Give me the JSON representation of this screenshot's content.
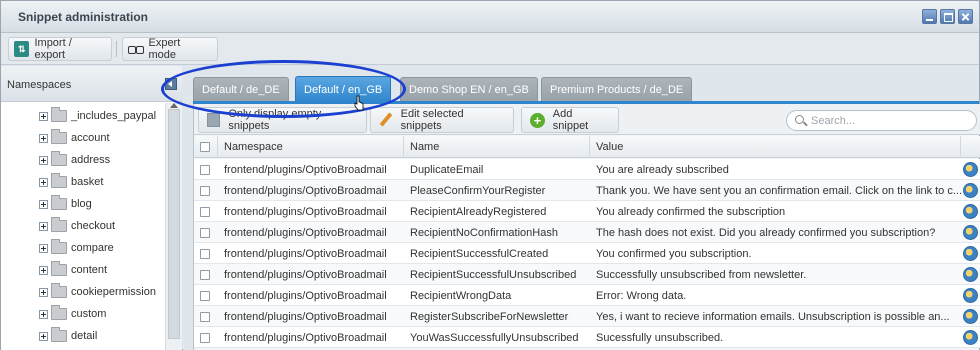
{
  "window": {
    "title": "Snippet administration"
  },
  "toolbar": {
    "import_label": "Import / export",
    "expert_label": "Expert mode"
  },
  "namespaces": {
    "header": "Namespaces",
    "items": [
      {
        "label": "_includes_paypal"
      },
      {
        "label": "account"
      },
      {
        "label": "address"
      },
      {
        "label": "basket"
      },
      {
        "label": "blog"
      },
      {
        "label": "checkout"
      },
      {
        "label": "compare"
      },
      {
        "label": "content"
      },
      {
        "label": "cookiepermission"
      },
      {
        "label": "custom"
      },
      {
        "label": "detail"
      }
    ]
  },
  "tabs": [
    {
      "label": "Default / de_DE",
      "active": false
    },
    {
      "label": "Default / en_GB",
      "active": true
    },
    {
      "label": "Demo Shop EN / en_GB",
      "active": false
    },
    {
      "label": "Premium Products / de_DE",
      "active": false
    }
  ],
  "grid_toolbar": {
    "filter_label": "Only display empty snippets",
    "edit_label": "Edit selected snippets",
    "add_label": "Add snippet",
    "search_placeholder": "Search..."
  },
  "grid": {
    "columns": [
      "Namespace",
      "Name",
      "Value"
    ],
    "rows": [
      {
        "namespace": "frontend/plugins/OptivoBroadmail",
        "name": "DuplicateEmail",
        "value": "You are already subscribed"
      },
      {
        "namespace": "frontend/plugins/OptivoBroadmail",
        "name": "PleaseConfirmYourRegister",
        "value": "Thank you. We have sent you an confirmation email. Click on the link to c..."
      },
      {
        "namespace": "frontend/plugins/OptivoBroadmail",
        "name": "RecipientAlreadyRegistered",
        "value": "You already confirmed the subscription"
      },
      {
        "namespace": "frontend/plugins/OptivoBroadmail",
        "name": "RecipientNoConfirmationHash",
        "value": "The hash does not exist. Did you already confirmed you subscription?"
      },
      {
        "namespace": "frontend/plugins/OptivoBroadmail",
        "name": "RecipientSuccessfulCreated",
        "value": "You confirmed you subscription."
      },
      {
        "namespace": "frontend/plugins/OptivoBroadmail",
        "name": "RecipientSuccessfulUnsubscribed",
        "value": "Successfully unsubscribed from newsletter."
      },
      {
        "namespace": "frontend/plugins/OptivoBroadmail",
        "name": "RecipientWrongData",
        "value": "Error: Wrong data."
      },
      {
        "namespace": "frontend/plugins/OptivoBroadmail",
        "name": "RegisterSubscribeForNewsletter",
        "value": "Yes, i want to recieve information emails. Unsubscription is possible an..."
      },
      {
        "namespace": "frontend/plugins/OptivoBroadmail",
        "name": "YouWasSuccessfullyUnsubscribed",
        "value": "Sucessfully unsubscribed."
      }
    ]
  },
  "colors": {
    "active_tab": "#2f86cd",
    "inactive_tab": "#a3abb2",
    "highlight_ellipse": "#1a3fd1"
  }
}
